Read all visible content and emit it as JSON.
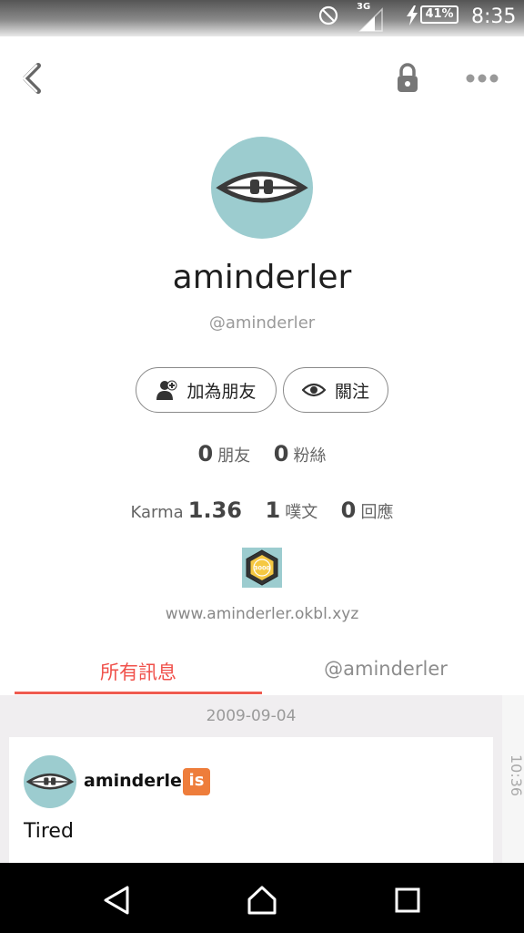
{
  "status_bar": {
    "network": "3G",
    "battery": "41%",
    "time": "8:35"
  },
  "toolbar": {
    "back_icon": "chevron-left-icon",
    "lock_icon": "lock-icon",
    "more_icon": "more-dots-icon"
  },
  "profile": {
    "display_name": "aminderler",
    "handle": "@aminderler",
    "website": "www.aminderler.okbl.xyz",
    "avatar_color": "#9ccccf"
  },
  "actions": {
    "add_friend_label": "加為朋友",
    "follow_label": "關注"
  },
  "stats": {
    "friends_count": "0",
    "friends_label": "朋友",
    "fans_count": "0",
    "fans_label": "粉絲",
    "karma_label": "Karma",
    "karma_value": "1.36",
    "plurks_count": "1",
    "plurks_label": "噗文",
    "responses_count": "0",
    "responses_label": "回應"
  },
  "badge": {
    "text": "3000",
    "icon": "hexagon-badge-icon"
  },
  "tabs": [
    {
      "label": "所有訊息",
      "active": true
    },
    {
      "label": "@aminderler",
      "active": false
    }
  ],
  "feed": {
    "date": "2009-09-04",
    "posts": [
      {
        "author": "aminderler",
        "qualifier": "is",
        "content": "Tired",
        "time": "10:36"
      }
    ]
  },
  "colors": {
    "accent": "#ef5a4f",
    "qualifier_is": "#ee7d3b"
  }
}
